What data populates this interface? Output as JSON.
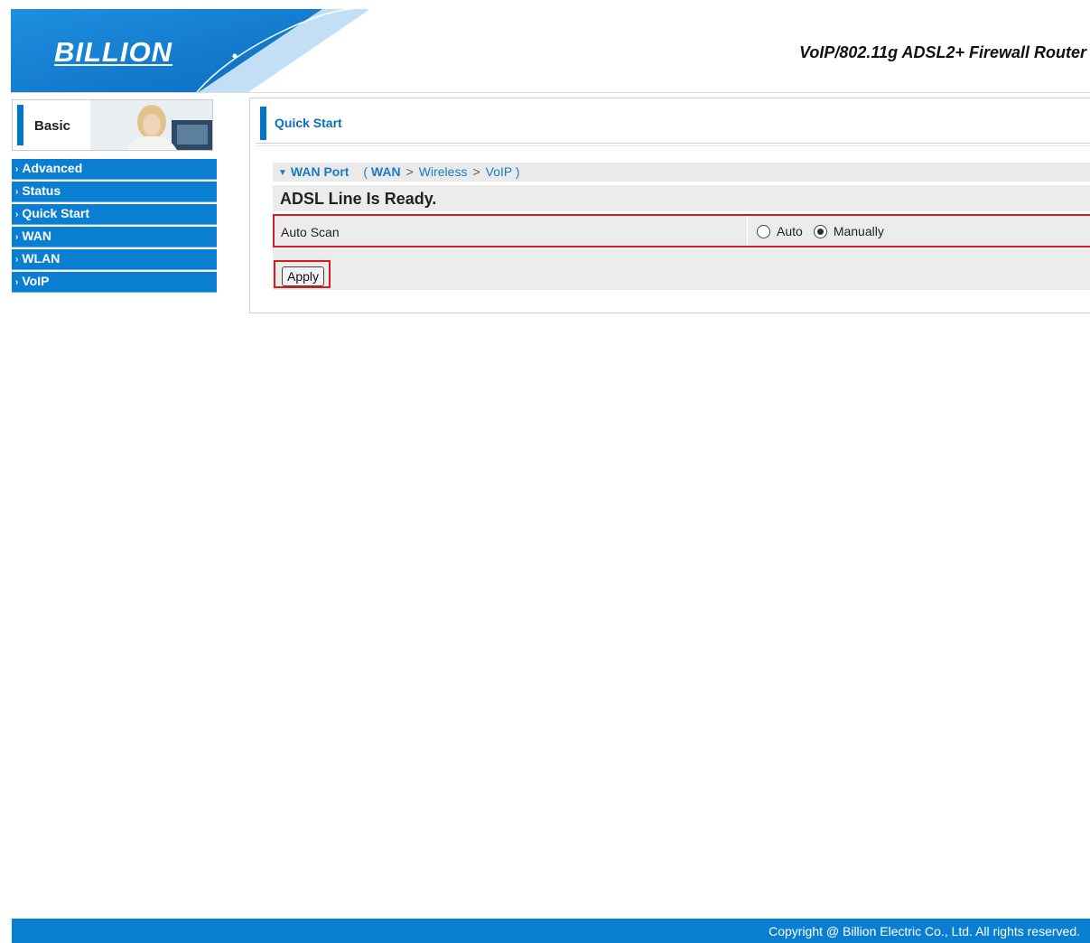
{
  "header": {
    "logo_text": "BILLION",
    "product_title": "VoIP/802.11g ADSL2+ Firewall Router"
  },
  "sidebar": {
    "basic_label": "Basic",
    "items": [
      {
        "label": "Advanced"
      },
      {
        "label": "Status"
      },
      {
        "label": "Quick Start"
      },
      {
        "label": "WAN"
      },
      {
        "label": "WLAN"
      },
      {
        "label": "VoIP"
      }
    ]
  },
  "main": {
    "section_title": "Quick Start",
    "breadcrumb": {
      "current": "WAN Port",
      "open_paren": "(",
      "step1": "WAN",
      "sep": ">",
      "step2": "Wireless",
      "step3": "VoIP",
      "close_paren": ")"
    },
    "status_text": "ADSL Line Is Ready.",
    "auto_scan": {
      "label": "Auto Scan",
      "options": [
        {
          "label": "Auto",
          "checked": false
        },
        {
          "label": "Manually",
          "checked": true
        }
      ]
    },
    "apply_label": "Apply"
  },
  "footer": {
    "copyright": "Copyright @ Billion Electric Co., Ltd. All rights reserved."
  },
  "colors": {
    "brand_blue": "#0a7fd2",
    "highlight_red": "#d41c1c"
  }
}
